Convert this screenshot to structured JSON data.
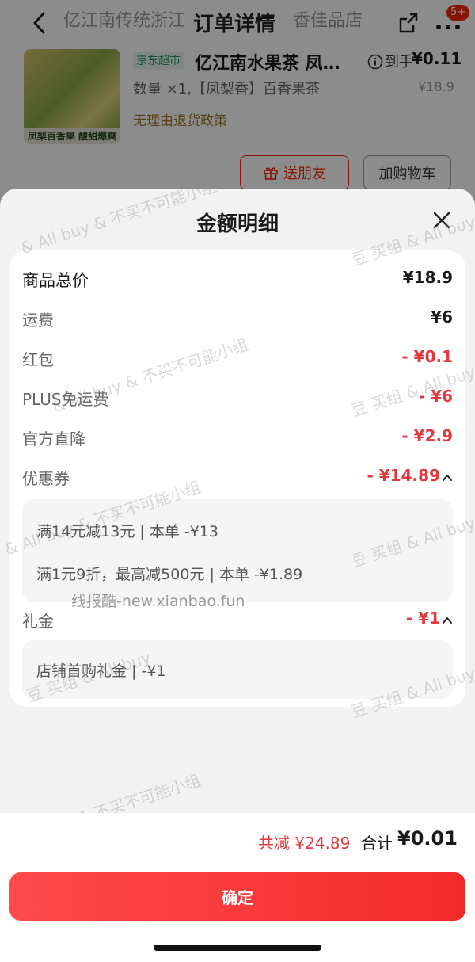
{
  "background_page": {
    "title_faint_left": "亿江南传统浙江",
    "title": "订单详情",
    "title_faint_right": "香佳品店",
    "badge": "5+",
    "product": {
      "tag": "京东超市",
      "name": "亿江南水果茶 凤…",
      "image_caption": "凤梨百香果 酸甜爆爽",
      "received_label": "到手",
      "received_price": "¥0.11",
      "original_price": "¥18.9",
      "spec": "数量 ×1,【凤梨香】百香果茶",
      "policy": "无理由退货政策"
    },
    "buttons": {
      "gift": "送朋友",
      "cart": "加购物车"
    }
  },
  "sheet": {
    "title": "金额明细",
    "rows": [
      {
        "label": "商品总价",
        "value": "¥18.9"
      },
      {
        "label": "运费",
        "value": "¥6"
      },
      {
        "label": "红包",
        "value": "- ¥0.1"
      },
      {
        "label": "PLUS免运费",
        "value": "- ¥6"
      },
      {
        "label": "官方直降",
        "value": "- ¥2.9"
      },
      {
        "label": "优惠券",
        "value": "- ¥14.89"
      },
      {
        "label": "礼金",
        "value": "- ¥1"
      }
    ],
    "coupon_details": [
      "满14元减13元 | 本单 -¥13",
      "满1元9折，最高减500元 | 本单 -¥1.89"
    ],
    "gift_money_details": [
      "店铺首购礼金 | -¥1"
    ]
  },
  "watermarks": {
    "line1": "豆 买组 & All buy",
    "line2": "& All buy & 不买不可能小组",
    "source": "线报酷-new.xianbao.fun"
  },
  "footer": {
    "saved": "共减 ¥24.89",
    "total_label": "合计",
    "total_value": "¥0.01",
    "confirm": "确定"
  },
  "colors": {
    "accent_red": "#e4393c",
    "button_red": "#f42a2a"
  }
}
